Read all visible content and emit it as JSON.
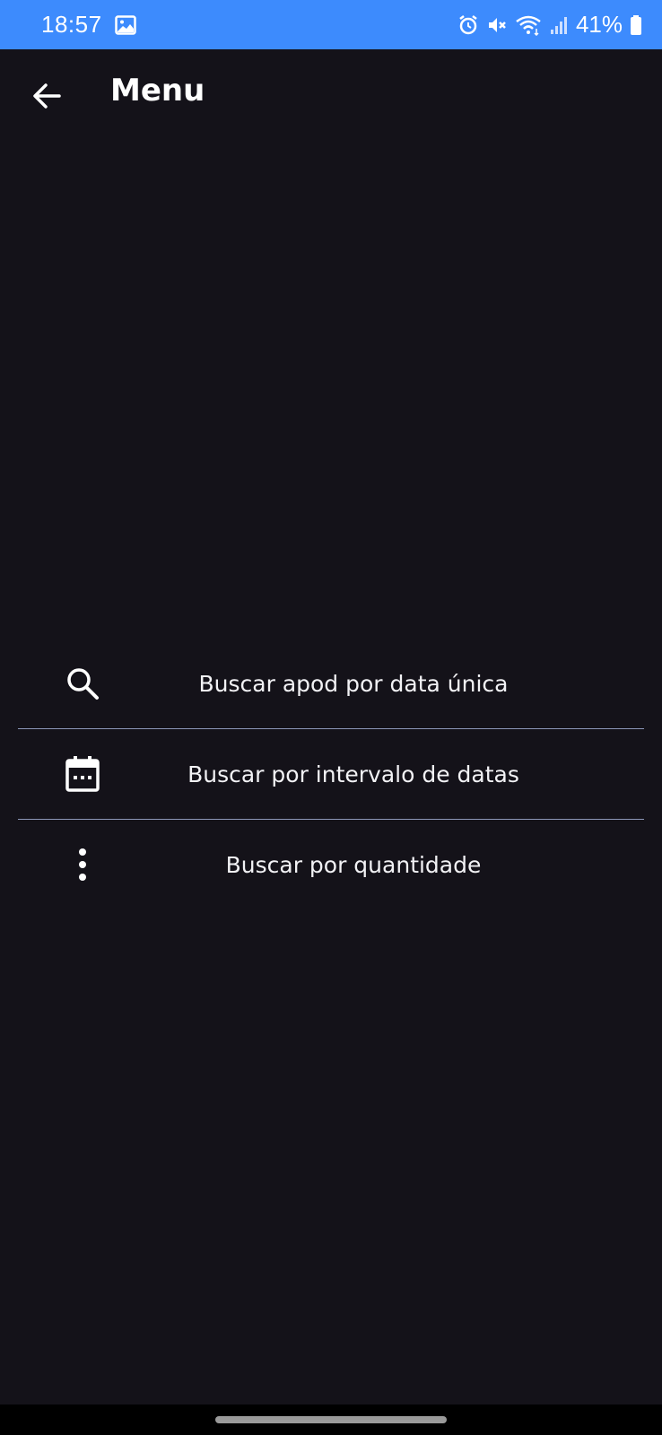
{
  "status_bar": {
    "time": "18:57",
    "battery": "41%",
    "icons": [
      "image-icon",
      "alarm-icon",
      "mute-icon",
      "wifi-icon",
      "signal-icon",
      "battery-icon"
    ],
    "background": "#3d8bfd"
  },
  "app_bar": {
    "title": "Menu",
    "back_icon": "arrow-left-icon"
  },
  "menu": {
    "items": [
      {
        "label": "Buscar apod por data única",
        "icon": "search-icon"
      },
      {
        "label": "Buscar por intervalo de datas",
        "icon": "calendar-icon"
      },
      {
        "label": "Buscar por quantidade",
        "icon": "more-vert-icon"
      }
    ]
  },
  "colors": {
    "background": "#141219",
    "divider": "#8c97b8",
    "text": "#ffffff"
  }
}
